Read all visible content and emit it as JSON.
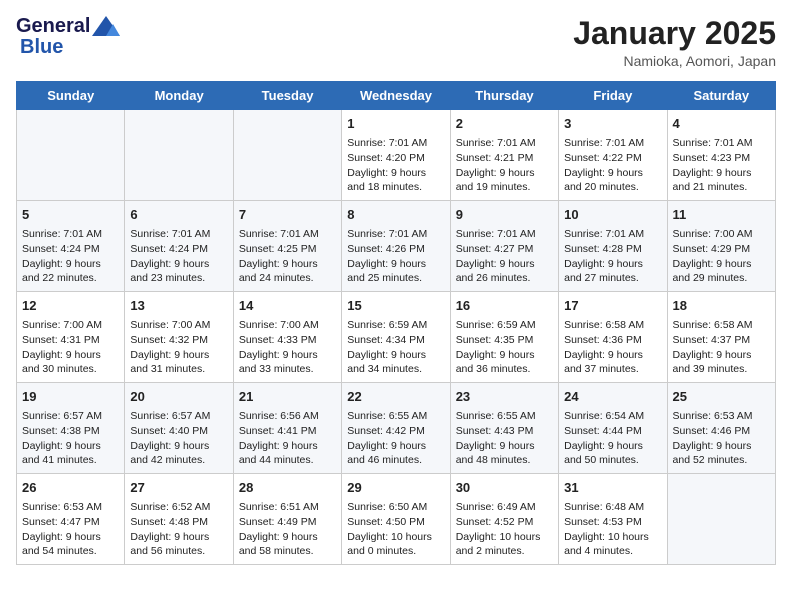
{
  "header": {
    "logo_general": "General",
    "logo_blue": "Blue",
    "month": "January 2025",
    "location": "Namioka, Aomori, Japan"
  },
  "weekdays": [
    "Sunday",
    "Monday",
    "Tuesday",
    "Wednesday",
    "Thursday",
    "Friday",
    "Saturday"
  ],
  "weeks": [
    [
      {
        "day": null,
        "data": null
      },
      {
        "day": null,
        "data": null
      },
      {
        "day": null,
        "data": null
      },
      {
        "day": "1",
        "data": {
          "sunrise": "Sunrise: 7:01 AM",
          "sunset": "Sunset: 4:20 PM",
          "daylight": "Daylight: 9 hours and 18 minutes."
        }
      },
      {
        "day": "2",
        "data": {
          "sunrise": "Sunrise: 7:01 AM",
          "sunset": "Sunset: 4:21 PM",
          "daylight": "Daylight: 9 hours and 19 minutes."
        }
      },
      {
        "day": "3",
        "data": {
          "sunrise": "Sunrise: 7:01 AM",
          "sunset": "Sunset: 4:22 PM",
          "daylight": "Daylight: 9 hours and 20 minutes."
        }
      },
      {
        "day": "4",
        "data": {
          "sunrise": "Sunrise: 7:01 AM",
          "sunset": "Sunset: 4:23 PM",
          "daylight": "Daylight: 9 hours and 21 minutes."
        }
      }
    ],
    [
      {
        "day": "5",
        "data": {
          "sunrise": "Sunrise: 7:01 AM",
          "sunset": "Sunset: 4:24 PM",
          "daylight": "Daylight: 9 hours and 22 minutes."
        }
      },
      {
        "day": "6",
        "data": {
          "sunrise": "Sunrise: 7:01 AM",
          "sunset": "Sunset: 4:24 PM",
          "daylight": "Daylight: 9 hours and 23 minutes."
        }
      },
      {
        "day": "7",
        "data": {
          "sunrise": "Sunrise: 7:01 AM",
          "sunset": "Sunset: 4:25 PM",
          "daylight": "Daylight: 9 hours and 24 minutes."
        }
      },
      {
        "day": "8",
        "data": {
          "sunrise": "Sunrise: 7:01 AM",
          "sunset": "Sunset: 4:26 PM",
          "daylight": "Daylight: 9 hours and 25 minutes."
        }
      },
      {
        "day": "9",
        "data": {
          "sunrise": "Sunrise: 7:01 AM",
          "sunset": "Sunset: 4:27 PM",
          "daylight": "Daylight: 9 hours and 26 minutes."
        }
      },
      {
        "day": "10",
        "data": {
          "sunrise": "Sunrise: 7:01 AM",
          "sunset": "Sunset: 4:28 PM",
          "daylight": "Daylight: 9 hours and 27 minutes."
        }
      },
      {
        "day": "11",
        "data": {
          "sunrise": "Sunrise: 7:00 AM",
          "sunset": "Sunset: 4:29 PM",
          "daylight": "Daylight: 9 hours and 29 minutes."
        }
      }
    ],
    [
      {
        "day": "12",
        "data": {
          "sunrise": "Sunrise: 7:00 AM",
          "sunset": "Sunset: 4:31 PM",
          "daylight": "Daylight: 9 hours and 30 minutes."
        }
      },
      {
        "day": "13",
        "data": {
          "sunrise": "Sunrise: 7:00 AM",
          "sunset": "Sunset: 4:32 PM",
          "daylight": "Daylight: 9 hours and 31 minutes."
        }
      },
      {
        "day": "14",
        "data": {
          "sunrise": "Sunrise: 7:00 AM",
          "sunset": "Sunset: 4:33 PM",
          "daylight": "Daylight: 9 hours and 33 minutes."
        }
      },
      {
        "day": "15",
        "data": {
          "sunrise": "Sunrise: 6:59 AM",
          "sunset": "Sunset: 4:34 PM",
          "daylight": "Daylight: 9 hours and 34 minutes."
        }
      },
      {
        "day": "16",
        "data": {
          "sunrise": "Sunrise: 6:59 AM",
          "sunset": "Sunset: 4:35 PM",
          "daylight": "Daylight: 9 hours and 36 minutes."
        }
      },
      {
        "day": "17",
        "data": {
          "sunrise": "Sunrise: 6:58 AM",
          "sunset": "Sunset: 4:36 PM",
          "daylight": "Daylight: 9 hours and 37 minutes."
        }
      },
      {
        "day": "18",
        "data": {
          "sunrise": "Sunrise: 6:58 AM",
          "sunset": "Sunset: 4:37 PM",
          "daylight": "Daylight: 9 hours and 39 minutes."
        }
      }
    ],
    [
      {
        "day": "19",
        "data": {
          "sunrise": "Sunrise: 6:57 AM",
          "sunset": "Sunset: 4:38 PM",
          "daylight": "Daylight: 9 hours and 41 minutes."
        }
      },
      {
        "day": "20",
        "data": {
          "sunrise": "Sunrise: 6:57 AM",
          "sunset": "Sunset: 4:40 PM",
          "daylight": "Daylight: 9 hours and 42 minutes."
        }
      },
      {
        "day": "21",
        "data": {
          "sunrise": "Sunrise: 6:56 AM",
          "sunset": "Sunset: 4:41 PM",
          "daylight": "Daylight: 9 hours and 44 minutes."
        }
      },
      {
        "day": "22",
        "data": {
          "sunrise": "Sunrise: 6:55 AM",
          "sunset": "Sunset: 4:42 PM",
          "daylight": "Daylight: 9 hours and 46 minutes."
        }
      },
      {
        "day": "23",
        "data": {
          "sunrise": "Sunrise: 6:55 AM",
          "sunset": "Sunset: 4:43 PM",
          "daylight": "Daylight: 9 hours and 48 minutes."
        }
      },
      {
        "day": "24",
        "data": {
          "sunrise": "Sunrise: 6:54 AM",
          "sunset": "Sunset: 4:44 PM",
          "daylight": "Daylight: 9 hours and 50 minutes."
        }
      },
      {
        "day": "25",
        "data": {
          "sunrise": "Sunrise: 6:53 AM",
          "sunset": "Sunset: 4:46 PM",
          "daylight": "Daylight: 9 hours and 52 minutes."
        }
      }
    ],
    [
      {
        "day": "26",
        "data": {
          "sunrise": "Sunrise: 6:53 AM",
          "sunset": "Sunset: 4:47 PM",
          "daylight": "Daylight: 9 hours and 54 minutes."
        }
      },
      {
        "day": "27",
        "data": {
          "sunrise": "Sunrise: 6:52 AM",
          "sunset": "Sunset: 4:48 PM",
          "daylight": "Daylight: 9 hours and 56 minutes."
        }
      },
      {
        "day": "28",
        "data": {
          "sunrise": "Sunrise: 6:51 AM",
          "sunset": "Sunset: 4:49 PM",
          "daylight": "Daylight: 9 hours and 58 minutes."
        }
      },
      {
        "day": "29",
        "data": {
          "sunrise": "Sunrise: 6:50 AM",
          "sunset": "Sunset: 4:50 PM",
          "daylight": "Daylight: 10 hours and 0 minutes."
        }
      },
      {
        "day": "30",
        "data": {
          "sunrise": "Sunrise: 6:49 AM",
          "sunset": "Sunset: 4:52 PM",
          "daylight": "Daylight: 10 hours and 2 minutes."
        }
      },
      {
        "day": "31",
        "data": {
          "sunrise": "Sunrise: 6:48 AM",
          "sunset": "Sunset: 4:53 PM",
          "daylight": "Daylight: 10 hours and 4 minutes."
        }
      },
      {
        "day": null,
        "data": null
      }
    ]
  ]
}
